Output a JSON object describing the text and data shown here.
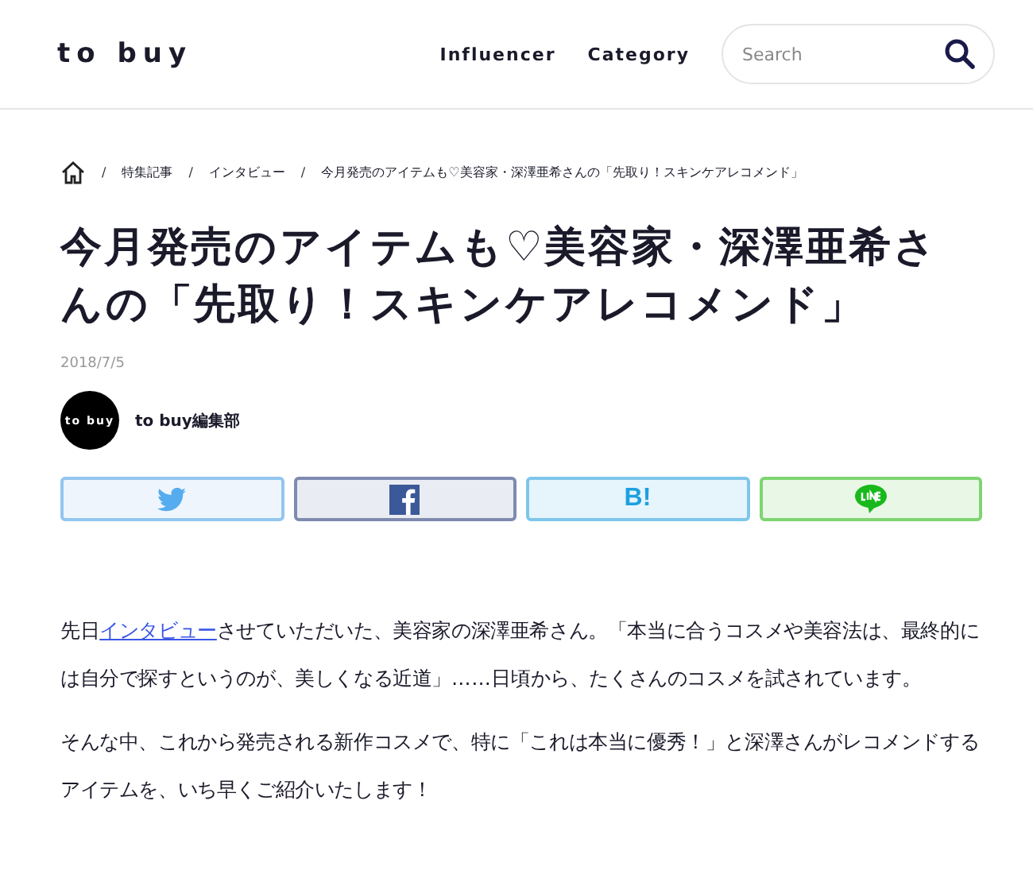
{
  "header": {
    "logo": "to buy",
    "nav": [
      "Influencer",
      "Category"
    ],
    "search": {
      "placeholder": "Search"
    }
  },
  "breadcrumb": [
    "特集記事",
    "インタビュー",
    "今月発売のアイテムも♡美容家・深澤亜希さんの「先取り！スキンケアレコメンド」"
  ],
  "separator": "/",
  "article": {
    "title": "今月発売のアイテムも♡美容家・深澤亜希さんの「先取り！スキンケアレコメンド」",
    "date": "2018/7/5",
    "author": {
      "avatar_text": "to buy",
      "name": "to buy編集部"
    },
    "share": [
      {
        "kind": "twitter"
      },
      {
        "kind": "facebook"
      },
      {
        "kind": "hatena",
        "label": "B!"
      },
      {
        "kind": "line"
      }
    ],
    "paragraphs": [
      {
        "before": "先日",
        "link": "インタビュー",
        "after": "させていただいた、美容家の深澤亜希さん。「本当に合うコスメや美容法は、最終的には自分で探すというのが、美しくなる近道」……日頃から、たくさんのコスメを試されています。"
      },
      {
        "before": "そんな中、これから発売される新作コスメで、特に「これは本当に優秀！」と深澤さんがレコメンドするアイテムを、いち早くご紹介いたします！"
      }
    ]
  }
}
